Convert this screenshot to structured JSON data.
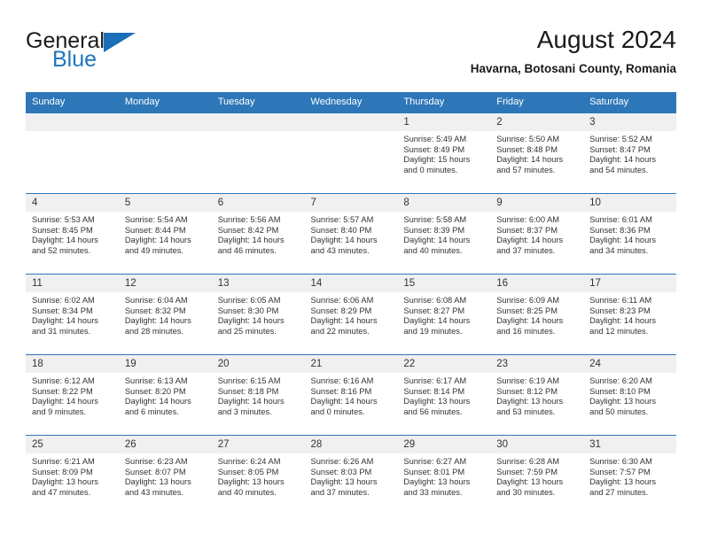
{
  "brand": {
    "line1": "General",
    "line2": "Blue",
    "triangle_color": "#1b6fb8"
  },
  "header": {
    "title": "August 2024",
    "subtitle": "Havarna, Botosani County, Romania"
  },
  "theme": {
    "header_blue": "#2d77b8",
    "daynum_gray": "#f0f0f0",
    "text": "#333333"
  },
  "weekday_headers": [
    "Sunday",
    "Monday",
    "Tuesday",
    "Wednesday",
    "Thursday",
    "Friday",
    "Saturday"
  ],
  "weeks": [
    [
      {
        "day": "",
        "lines": []
      },
      {
        "day": "",
        "lines": []
      },
      {
        "day": "",
        "lines": []
      },
      {
        "day": "",
        "lines": []
      },
      {
        "day": "1",
        "lines": [
          "Sunrise: 5:49 AM",
          "Sunset: 8:49 PM",
          "Daylight: 15 hours",
          "and 0 minutes."
        ]
      },
      {
        "day": "2",
        "lines": [
          "Sunrise: 5:50 AM",
          "Sunset: 8:48 PM",
          "Daylight: 14 hours",
          "and 57 minutes."
        ]
      },
      {
        "day": "3",
        "lines": [
          "Sunrise: 5:52 AM",
          "Sunset: 8:47 PM",
          "Daylight: 14 hours",
          "and 54 minutes."
        ]
      }
    ],
    [
      {
        "day": "4",
        "lines": [
          "Sunrise: 5:53 AM",
          "Sunset: 8:45 PM",
          "Daylight: 14 hours",
          "and 52 minutes."
        ]
      },
      {
        "day": "5",
        "lines": [
          "Sunrise: 5:54 AM",
          "Sunset: 8:44 PM",
          "Daylight: 14 hours",
          "and 49 minutes."
        ]
      },
      {
        "day": "6",
        "lines": [
          "Sunrise: 5:56 AM",
          "Sunset: 8:42 PM",
          "Daylight: 14 hours",
          "and 46 minutes."
        ]
      },
      {
        "day": "7",
        "lines": [
          "Sunrise: 5:57 AM",
          "Sunset: 8:40 PM",
          "Daylight: 14 hours",
          "and 43 minutes."
        ]
      },
      {
        "day": "8",
        "lines": [
          "Sunrise: 5:58 AM",
          "Sunset: 8:39 PM",
          "Daylight: 14 hours",
          "and 40 minutes."
        ]
      },
      {
        "day": "9",
        "lines": [
          "Sunrise: 6:00 AM",
          "Sunset: 8:37 PM",
          "Daylight: 14 hours",
          "and 37 minutes."
        ]
      },
      {
        "day": "10",
        "lines": [
          "Sunrise: 6:01 AM",
          "Sunset: 8:36 PM",
          "Daylight: 14 hours",
          "and 34 minutes."
        ]
      }
    ],
    [
      {
        "day": "11",
        "lines": [
          "Sunrise: 6:02 AM",
          "Sunset: 8:34 PM",
          "Daylight: 14 hours",
          "and 31 minutes."
        ]
      },
      {
        "day": "12",
        "lines": [
          "Sunrise: 6:04 AM",
          "Sunset: 8:32 PM",
          "Daylight: 14 hours",
          "and 28 minutes."
        ]
      },
      {
        "day": "13",
        "lines": [
          "Sunrise: 6:05 AM",
          "Sunset: 8:30 PM",
          "Daylight: 14 hours",
          "and 25 minutes."
        ]
      },
      {
        "day": "14",
        "lines": [
          "Sunrise: 6:06 AM",
          "Sunset: 8:29 PM",
          "Daylight: 14 hours",
          "and 22 minutes."
        ]
      },
      {
        "day": "15",
        "lines": [
          "Sunrise: 6:08 AM",
          "Sunset: 8:27 PM",
          "Daylight: 14 hours",
          "and 19 minutes."
        ]
      },
      {
        "day": "16",
        "lines": [
          "Sunrise: 6:09 AM",
          "Sunset: 8:25 PM",
          "Daylight: 14 hours",
          "and 16 minutes."
        ]
      },
      {
        "day": "17",
        "lines": [
          "Sunrise: 6:11 AM",
          "Sunset: 8:23 PM",
          "Daylight: 14 hours",
          "and 12 minutes."
        ]
      }
    ],
    [
      {
        "day": "18",
        "lines": [
          "Sunrise: 6:12 AM",
          "Sunset: 8:22 PM",
          "Daylight: 14 hours",
          "and 9 minutes."
        ]
      },
      {
        "day": "19",
        "lines": [
          "Sunrise: 6:13 AM",
          "Sunset: 8:20 PM",
          "Daylight: 14 hours",
          "and 6 minutes."
        ]
      },
      {
        "day": "20",
        "lines": [
          "Sunrise: 6:15 AM",
          "Sunset: 8:18 PM",
          "Daylight: 14 hours",
          "and 3 minutes."
        ]
      },
      {
        "day": "21",
        "lines": [
          "Sunrise: 6:16 AM",
          "Sunset: 8:16 PM",
          "Daylight: 14 hours",
          "and 0 minutes."
        ]
      },
      {
        "day": "22",
        "lines": [
          "Sunrise: 6:17 AM",
          "Sunset: 8:14 PM",
          "Daylight: 13 hours",
          "and 56 minutes."
        ]
      },
      {
        "day": "23",
        "lines": [
          "Sunrise: 6:19 AM",
          "Sunset: 8:12 PM",
          "Daylight: 13 hours",
          "and 53 minutes."
        ]
      },
      {
        "day": "24",
        "lines": [
          "Sunrise: 6:20 AM",
          "Sunset: 8:10 PM",
          "Daylight: 13 hours",
          "and 50 minutes."
        ]
      }
    ],
    [
      {
        "day": "25",
        "lines": [
          "Sunrise: 6:21 AM",
          "Sunset: 8:09 PM",
          "Daylight: 13 hours",
          "and 47 minutes."
        ]
      },
      {
        "day": "26",
        "lines": [
          "Sunrise: 6:23 AM",
          "Sunset: 8:07 PM",
          "Daylight: 13 hours",
          "and 43 minutes."
        ]
      },
      {
        "day": "27",
        "lines": [
          "Sunrise: 6:24 AM",
          "Sunset: 8:05 PM",
          "Daylight: 13 hours",
          "and 40 minutes."
        ]
      },
      {
        "day": "28",
        "lines": [
          "Sunrise: 6:26 AM",
          "Sunset: 8:03 PM",
          "Daylight: 13 hours",
          "and 37 minutes."
        ]
      },
      {
        "day": "29",
        "lines": [
          "Sunrise: 6:27 AM",
          "Sunset: 8:01 PM",
          "Daylight: 13 hours",
          "and 33 minutes."
        ]
      },
      {
        "day": "30",
        "lines": [
          "Sunrise: 6:28 AM",
          "Sunset: 7:59 PM",
          "Daylight: 13 hours",
          "and 30 minutes."
        ]
      },
      {
        "day": "31",
        "lines": [
          "Sunrise: 6:30 AM",
          "Sunset: 7:57 PM",
          "Daylight: 13 hours",
          "and 27 minutes."
        ]
      }
    ]
  ]
}
